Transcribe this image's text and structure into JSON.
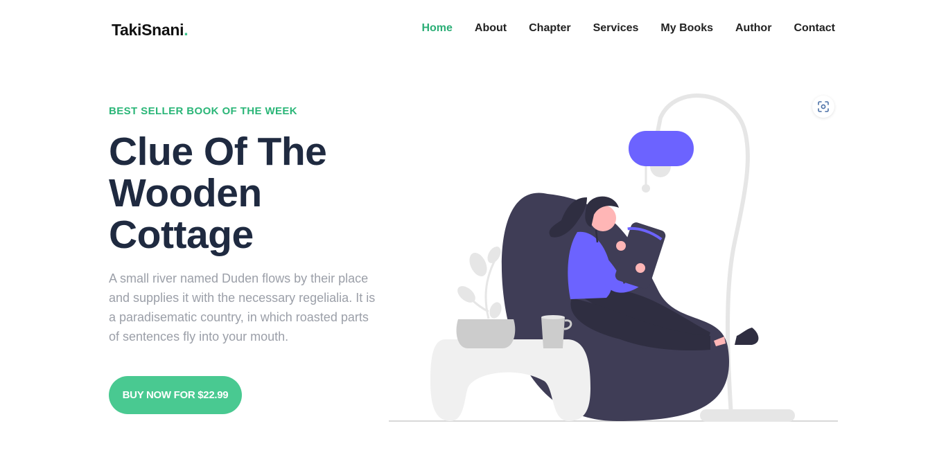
{
  "brand": {
    "name": "TakiSnani",
    "dot": "."
  },
  "nav": {
    "items": [
      {
        "label": "Home",
        "active": true
      },
      {
        "label": "About",
        "active": false
      },
      {
        "label": "Chapter",
        "active": false
      },
      {
        "label": "Services",
        "active": false
      },
      {
        "label": "My Books",
        "active": false
      },
      {
        "label": "Author",
        "active": false
      },
      {
        "label": "Contact",
        "active": false
      }
    ]
  },
  "hero": {
    "eyebrow": "BEST SELLER BOOK OF THE WEEK",
    "title_line1": "Clue Of The",
    "title_line2": "Wooden",
    "title_line3": "Cottage",
    "description": "A small river named Duden flows by their place and supplies it with the necessary regelialia. It is a paradisematic country, in which roasted parts of sentences fly into your mouth.",
    "cta_label": "BUY NOW FOR $22.99"
  },
  "icons": {
    "scan": "scan-icon"
  },
  "colors": {
    "accent": "#49c991",
    "nav_active": "#2bae76",
    "title": "#1f2a40",
    "chair": "#3f3d56",
    "shirt": "#6c63ff",
    "lamp_shade": "#6c63ff"
  }
}
